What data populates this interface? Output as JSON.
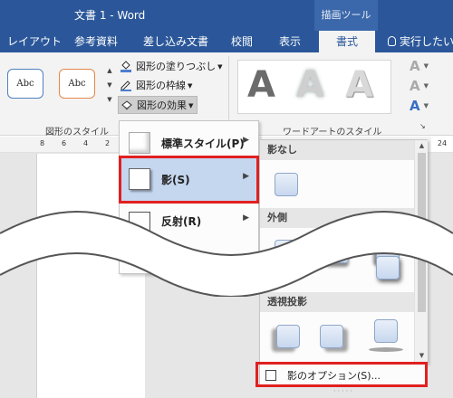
{
  "titlebar": {
    "document_title": "文書 1 - Word",
    "context_tab_group": "描画ツール"
  },
  "tabs": [
    {
      "label": "レイアウト",
      "active": false
    },
    {
      "label": "参考資料",
      "active": false
    },
    {
      "label": "差し込み文書",
      "active": false
    },
    {
      "label": "校閲",
      "active": false
    },
    {
      "label": "表示",
      "active": false
    },
    {
      "label": "書式",
      "active": true
    }
  ],
  "tell_me": {
    "label": "実行したい"
  },
  "ribbon": {
    "shape_styles": {
      "samples": [
        "Abc",
        "Abc"
      ],
      "fill_label": "図形の塗りつぶし",
      "outline_label": "図形の枠線",
      "effect_label": "図形の効果",
      "group_label": "図形のスタイル"
    },
    "wordart": {
      "samples": [
        "A",
        "A",
        "A"
      ],
      "text_fill_glyph": "A",
      "text_outline_glyph": "A",
      "text_effect_glyph": "A",
      "group_label": "ワードアートのスタイル"
    }
  },
  "ruler": {
    "left_numbers": [
      "8",
      "6",
      "4",
      "2"
    ],
    "right_number": "24"
  },
  "effects_menu": {
    "items": [
      {
        "label": "標準スタイル(P)",
        "icon": "standard-style-icon",
        "selected": false
      },
      {
        "label": "影(S)",
        "icon": "shadow-icon",
        "selected": true
      },
      {
        "label": "反射(R)",
        "icon": "reflection-icon",
        "selected": false
      }
    ],
    "submenu_arrow": "▶"
  },
  "shadow_gallery": {
    "header_none": "影なし",
    "header_outer": "外側",
    "header_perspective": "透視投影",
    "options_label": "影のオプション(S)..."
  },
  "colors": {
    "title_bar": "#2b579a",
    "selected_item": "#c5d6ef",
    "highlight_border": "#e02020"
  }
}
